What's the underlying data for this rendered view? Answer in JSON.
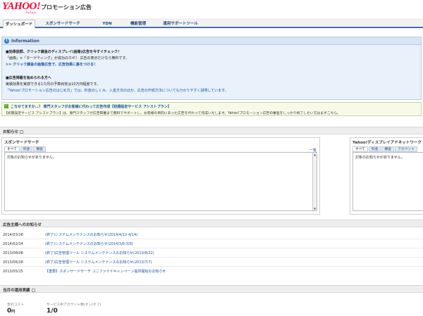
{
  "header": {
    "logo_text": "YAHOO!",
    "logo_sub": "JAPAN",
    "title": "プロモーション広告"
  },
  "tabs": [
    {
      "label": "ダッシュボード",
      "active": true
    },
    {
      "label": "スポンサードサーチ",
      "active": false
    },
    {
      "label": "YDN",
      "active": false
    },
    {
      "label": "機能管理",
      "active": false
    },
    {
      "label": "運用サポートツール",
      "active": false
    }
  ],
  "information": {
    "title": "Information",
    "icon": "info-icon",
    "lines": [
      "■効果抜群、クリック課金のディスプレイ(画像)広告を今すぐチェック！",
      "「画像」×「ターゲティング」が成功のカギ！ 広告の表示だけなら無料です。",
      ">> クリック課金の画像広告で、広告効果に差をつける！",
      "■広告掲載を始められる方へ",
      "実績効果を実感できる1カ月の予算目安は10万円程度です。",
      "「Yahoo!プロモーション広告のはじめ方」では、料金のしくみ、入金方法のほか、広告の作成方法についても分かりやすく説明しています。"
    ]
  },
  "promo": {
    "title": "こなせてますか…？ 専門スタッフがお客様に代わって広告作成【初期設定サービス アシストプラン】",
    "text": "【初期設定サービス アシストプラン】は、専門スタッフが広告掲載まで無料でサポートし、お客様の目的にあった広告を代わって作成いたします。Yahoo!プロモーション広告の審査をしっかり終了したい方はまずこちら。"
  },
  "news": {
    "title": "お知らせ",
    "sponsored": {
      "title": "スポンサードサーチ",
      "link": "一覧",
      "tabs": [
        "すべて",
        "料金",
        "審査"
      ],
      "empty": "対象のお知らせがありません。"
    },
    "ydn": {
      "title": "Yahoo!ディスプレイアドネットワーク",
      "tabs": [
        "すべて",
        "料金",
        "審査",
        "アカウント"
      ],
      "empty": "対象のお知らせがありません。"
    }
  },
  "ad_system": {
    "title": "広告主様へのお知らせ",
    "items": [
      {
        "date": "2014/03/28",
        "title": "(終了)システムメンテナンスのお知らせ(2014/4/12-4/14)"
      },
      {
        "date": "2014/02/24",
        "title": "(終了)システムメンテナンスのお知らせ(2014/3/8-3/9)"
      },
      {
        "date": "2013/08/08",
        "title": "(終了)広告管理ツール システムメンテナンスのお知らせ(2013/8/22)"
      },
      {
        "date": "2013/06/28",
        "title": "(終了)広告管理ツール システムメンテナンスのお知らせ(2013/7/7)"
      },
      {
        "date": "2013/05/15",
        "title": "【重要】スポンサードサーチ ユニファイドキャンペーン提供開始のお知らせ"
      }
    ]
  },
  "monthly": {
    "title": "当月の運用実績",
    "cost_label": "合計コスト",
    "cost_value": "0",
    "cost_unit": "円",
    "accounts_label": "サービス中アカウント数(オン/オフ)",
    "accounts_value": "1/0"
  },
  "colors": {
    "tab_border": "#4a6fa5",
    "info_bg": "#e9f1fa",
    "link": "#1a55a8",
    "logo": "#ff0033"
  }
}
